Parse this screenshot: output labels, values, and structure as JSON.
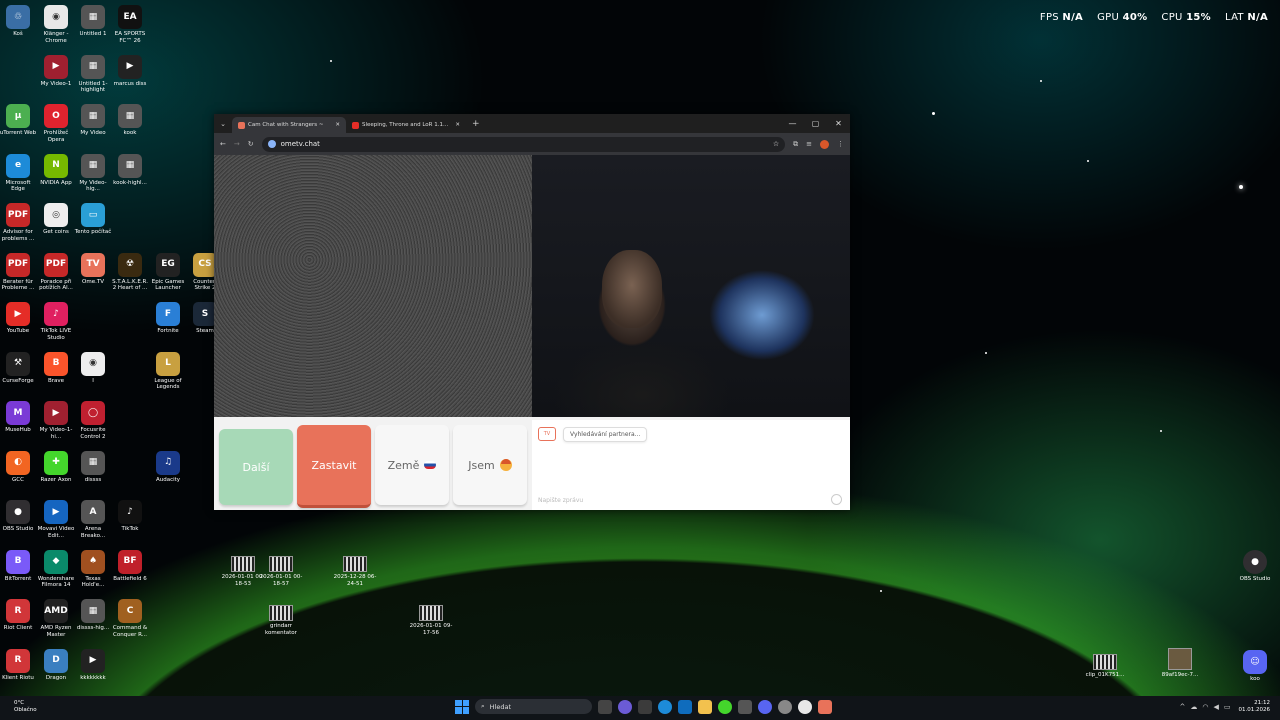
{
  "hud": {
    "fps_label": "FPS",
    "fps_value": "N/A",
    "gpu_label": "GPU",
    "gpu_value": "40%",
    "cpu_label": "CPU",
    "cpu_value": "15%",
    "lat_label": "LAT",
    "lat_value": "N/A"
  },
  "desktop_icons": [
    {
      "label": "Koš",
      "color": "#3a6ea5",
      "glyph": "♲"
    },
    {
      "label": "Klänger - Chrome",
      "color": "#e8e8e8",
      "glyph": "◉"
    },
    {
      "label": "Untitled 1",
      "color": "#555",
      "glyph": "▦"
    },
    {
      "label": "EA SPORTS FC™ 26",
      "color": "#111",
      "glyph": "EA"
    },
    {
      "label": "My Video-1",
      "color": "#a02030",
      "glyph": "▶"
    },
    {
      "label": "Untitled 1-highlight",
      "color": "#555",
      "glyph": "▦"
    },
    {
      "label": "marcus diss",
      "color": "#222",
      "glyph": "▶"
    },
    {
      "label": "uTorrent Web",
      "color": "#4caf50",
      "glyph": "µ"
    },
    {
      "label": "Prohlížeč Opera",
      "color": "#e0232e",
      "glyph": "O"
    },
    {
      "label": "My Video",
      "color": "#555",
      "glyph": "▦"
    },
    {
      "label": "kook",
      "color": "#555",
      "glyph": "▦"
    },
    {
      "label": "Microsoft Edge",
      "color": "#1d8bd8",
      "glyph": "e"
    },
    {
      "label": "NVIDIA App",
      "color": "#76b900",
      "glyph": "N"
    },
    {
      "label": "My Video-hig...",
      "color": "#555",
      "glyph": "▦"
    },
    {
      "label": "kook-highl...",
      "color": "#555",
      "glyph": "▦"
    },
    {
      "label": "Advisor for problems ...",
      "color": "#c62828",
      "glyph": "PDF"
    },
    {
      "label": "Get coins",
      "color": "#eee",
      "glyph": "◎"
    },
    {
      "label": "Tento počítač",
      "color": "#2a9fd6",
      "glyph": "▭"
    },
    {
      "label": "Berater für Probleme ...",
      "color": "#c62828",
      "glyph": "PDF"
    },
    {
      "label": "Poradce při potížích Al...",
      "color": "#c62828",
      "glyph": "PDF"
    },
    {
      "label": "Ome.TV",
      "color": "#e8725a",
      "glyph": "TV"
    },
    {
      "label": "S.T.A.L.K.E.R. 2 Heart of ...",
      "color": "#3a2a10",
      "glyph": "☢"
    },
    {
      "label": "Epic Games Launcher",
      "color": "#222",
      "glyph": "EG"
    },
    {
      "label": "Counter-Strike 2",
      "color": "#c8a040",
      "glyph": "CS"
    },
    {
      "label": "YouTube",
      "color": "#e52d27",
      "glyph": "▶"
    },
    {
      "label": "TikTok LIVE Studio",
      "color": "#e02060",
      "glyph": "♪"
    },
    {
      "label": "Fortnite",
      "color": "#2a7fd6",
      "glyph": "F"
    },
    {
      "label": "Steam",
      "color": "#1b2838",
      "glyph": "S"
    },
    {
      "label": "CurseForge",
      "color": "#222",
      "glyph": "⚒"
    },
    {
      "label": "Brave",
      "color": "#fb542b",
      "glyph": "B"
    },
    {
      "label": "I",
      "color": "#eee",
      "glyph": "◉"
    },
    {
      "label": "League of Legends",
      "color": "#c8a040",
      "glyph": "L"
    },
    {
      "label": "MuseHub",
      "color": "#7a3ad6",
      "glyph": "M"
    },
    {
      "label": "My Video-1-hi...",
      "color": "#a02030",
      "glyph": "▶"
    },
    {
      "label": "Focusrite Control 2",
      "color": "#c02030",
      "glyph": "◯"
    },
    {
      "label": "GCC",
      "color": "#f26522",
      "glyph": "◐"
    },
    {
      "label": "Razer Axon",
      "color": "#44d62c",
      "glyph": "✚"
    },
    {
      "label": "dissss",
      "color": "#555",
      "glyph": "▦"
    },
    {
      "label": "Audacity",
      "color": "#1a3a8a",
      "glyph": "♫"
    },
    {
      "label": "OBS Studio",
      "color": "#302e31",
      "glyph": "●"
    },
    {
      "label": "Movavi Video Edit...",
      "color": "#1565c0",
      "glyph": "▶"
    },
    {
      "label": "Arena Breako...",
      "color": "#555",
      "glyph": "A"
    },
    {
      "label": "TikTok",
      "color": "#111",
      "glyph": "♪"
    },
    {
      "label": "BitTorrent",
      "color": "#7a5af8",
      "glyph": "B"
    },
    {
      "label": "Wondershare Filmora 14",
      "color": "#0a8a6a",
      "glyph": "◆"
    },
    {
      "label": "Texas Hold'e...",
      "color": "#a05020",
      "glyph": "♠"
    },
    {
      "label": "Battlefield 6",
      "color": "#c0202a",
      "glyph": "BF"
    },
    {
      "label": "Riot Client",
      "color": "#d13639",
      "glyph": "R"
    },
    {
      "label": "AMD Ryzen Master",
      "color": "#222",
      "glyph": "AMD"
    },
    {
      "label": "dissss-hig...",
      "color": "#555",
      "glyph": "▦"
    },
    {
      "label": "Command & Conquer R...",
      "color": "#a06020",
      "glyph": "C"
    },
    {
      "label": "Klient Riotu",
      "color": "#d13639",
      "glyph": "R"
    },
    {
      "label": "Dragon",
      "color": "#3a7fc0",
      "glyph": "D"
    },
    {
      "label": "kkkkkkkk",
      "color": "#222",
      "glyph": "▶"
    }
  ],
  "files": [
    {
      "label": "2026-01-01 00-18-53"
    },
    {
      "label": "2026-01-01 00-18-57"
    },
    {
      "label": "2025-12-28 06-24-51"
    },
    {
      "label": "grindarr komentator"
    },
    {
      "label": "2026-01-01 09-17-56"
    },
    {
      "label": "clip_01K751..."
    },
    {
      "label": "89af19ec-7..."
    }
  ],
  "right_icons": {
    "obs": "OBS Studio",
    "discord": "koo"
  },
  "browser": {
    "tabs": [
      {
        "title": "Cam Chat with Strangers ~",
        "color": "#e8725a"
      },
      {
        "title": "Sleeping, Throne and LoR 1.1...",
        "color": "#e52d27"
      }
    ],
    "new_tab": "+",
    "url": "ometv.chat",
    "win_min": "—",
    "win_max": "▢",
    "win_close": "✕"
  },
  "omegle": {
    "next_label": "Další",
    "stop_label": "Zastavit",
    "country_label": "Země",
    "gender_label": "Jsem",
    "status_text": "Vyhledávání partnera...",
    "logo_text": "TV",
    "message_placeholder": "Napište zprávu"
  },
  "taskbar": {
    "weather_temp": "0°C",
    "weather_desc": "Oblačno",
    "search_label": "Hledat",
    "time": "21:12",
    "date": "01.01.2026"
  }
}
